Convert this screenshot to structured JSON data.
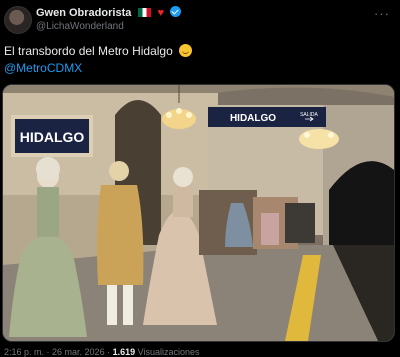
{
  "post": {
    "author_name": "Gwen Obradorista",
    "handle": "@LichaWonderland",
    "more_label": "···",
    "text": "El transbordo del Metro Hidalgo",
    "mention": "@MetroCDMX"
  },
  "image": {
    "sign_left": "HIDALGO",
    "sign_right": "HIDALGO",
    "sign_salida": "SALIDA"
  },
  "footer": {
    "time": "2:16 p. m.",
    "date": "26 mar. 2026",
    "views_count": "1.619",
    "views_label": "Visualizaciones"
  }
}
